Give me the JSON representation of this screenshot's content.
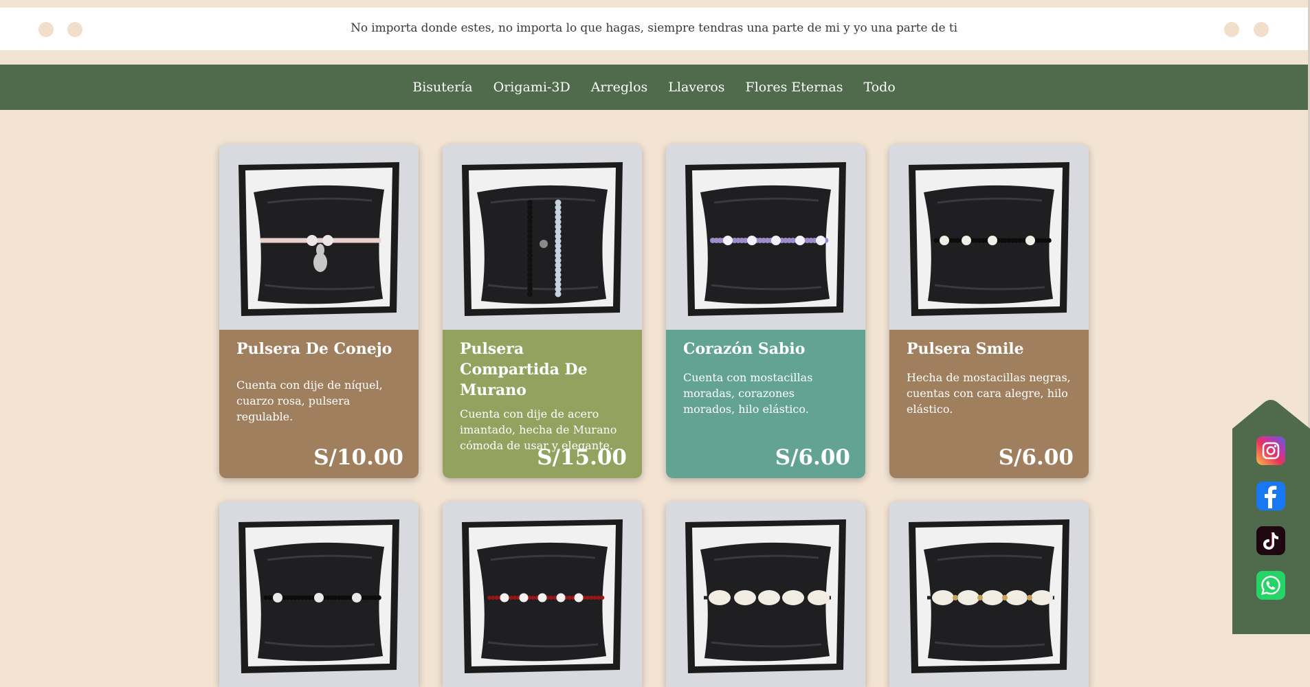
{
  "announcement": "No importa donde estes, no importa lo que hagas, siempre tendras una parte de mi y yo una parte de ti",
  "nav": [
    "Bisutería",
    "Origami-3D",
    "Arreglos",
    "Llaveros",
    "Flores Eternas",
    "Todo"
  ],
  "products": [
    {
      "name": "Pulsera De Conejo",
      "description": "Cuenta con dije de níquel, cuarzo rosa, pulsera regulable.",
      "price": "S/10.00",
      "color": "#a07f5f",
      "bracelet": "pink-bunny"
    },
    {
      "name": "Pulsera Compartida De Murano",
      "description": "Cuenta con dije de acero imantado, hecha de Murano cómoda de usar y elegante.",
      "price": "S/15.00",
      "color": "#93a35f",
      "bracelet": "dual"
    },
    {
      "name": "Corazón Sabio",
      "description": "Cuenta con mostacillas moradas, corazones morados, hilo elástico.",
      "price": "S/6.00",
      "color": "#63a394",
      "bracelet": "purple-hearts"
    },
    {
      "name": "Pulsera Smile",
      "description": "Hecha de mostacillas negras, cuentas con cara alegre, hilo elástico.",
      "price": "S/6.00",
      "color": "#a07f5f",
      "bracelet": "smile"
    }
  ],
  "products_row2": [
    {
      "bracelet": "black-smile"
    },
    {
      "bracelet": "red-hearts"
    },
    {
      "bracelet": "shells"
    },
    {
      "bracelet": "shells-gold"
    }
  ],
  "social": [
    "instagram-icon",
    "facebook-icon",
    "tiktok-icon",
    "whatsapp-icon"
  ],
  "colors": {
    "background": "#f2e3d3",
    "nav": "#4f6b4c",
    "social_panel": "#4f6b4c"
  }
}
